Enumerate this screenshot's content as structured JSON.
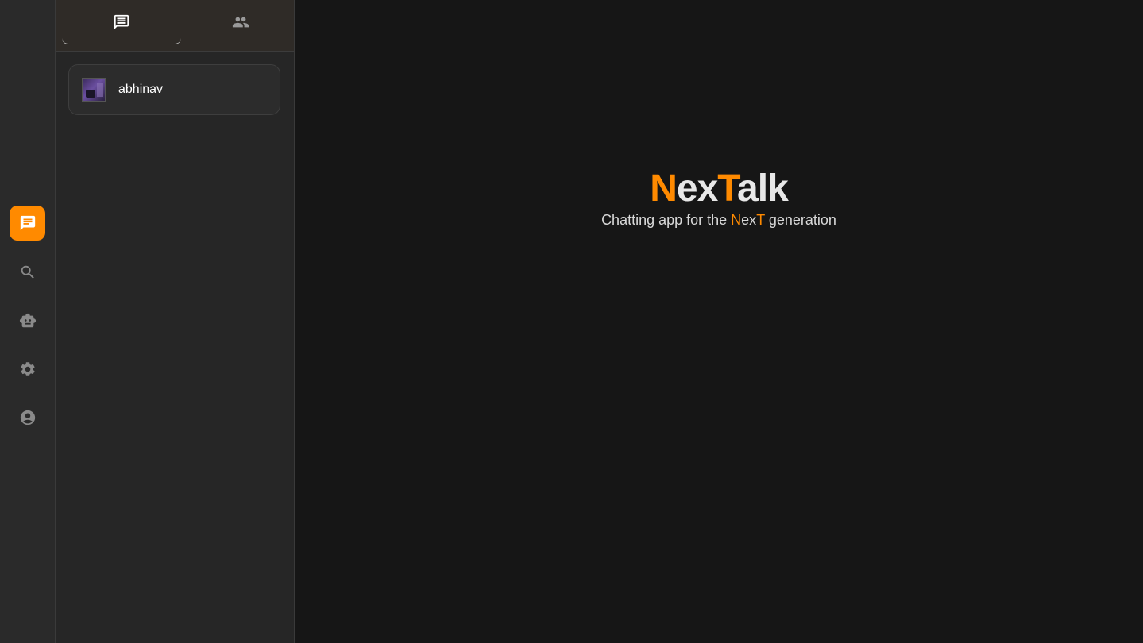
{
  "colors": {
    "accent": "#ff8a00",
    "rail_bg": "#2a2a2a",
    "panel_bg": "#262626",
    "main_bg": "#161616"
  },
  "rail": {
    "items": [
      {
        "name": "chats",
        "icon": "chat-icon",
        "active": true
      },
      {
        "name": "search",
        "icon": "search-icon",
        "active": false
      },
      {
        "name": "bot",
        "icon": "robot-icon",
        "active": false
      },
      {
        "name": "settings",
        "icon": "gear-icon",
        "active": false
      },
      {
        "name": "profile",
        "icon": "account-circle-icon",
        "active": false
      }
    ]
  },
  "tabs": [
    {
      "icon": "chat-list-icon",
      "selected": true
    },
    {
      "icon": "people-icon",
      "selected": false
    }
  ],
  "chats": [
    {
      "name": "abhinav",
      "avatar": "avatar-image"
    }
  ],
  "brand": {
    "title_parts": [
      "N",
      "ex",
      "T",
      "alk"
    ],
    "subtitle_prefix": "Chatting app for the ",
    "subtitle_accent_parts": [
      "N",
      "ex",
      "T"
    ],
    "subtitle_suffix": " generation"
  }
}
